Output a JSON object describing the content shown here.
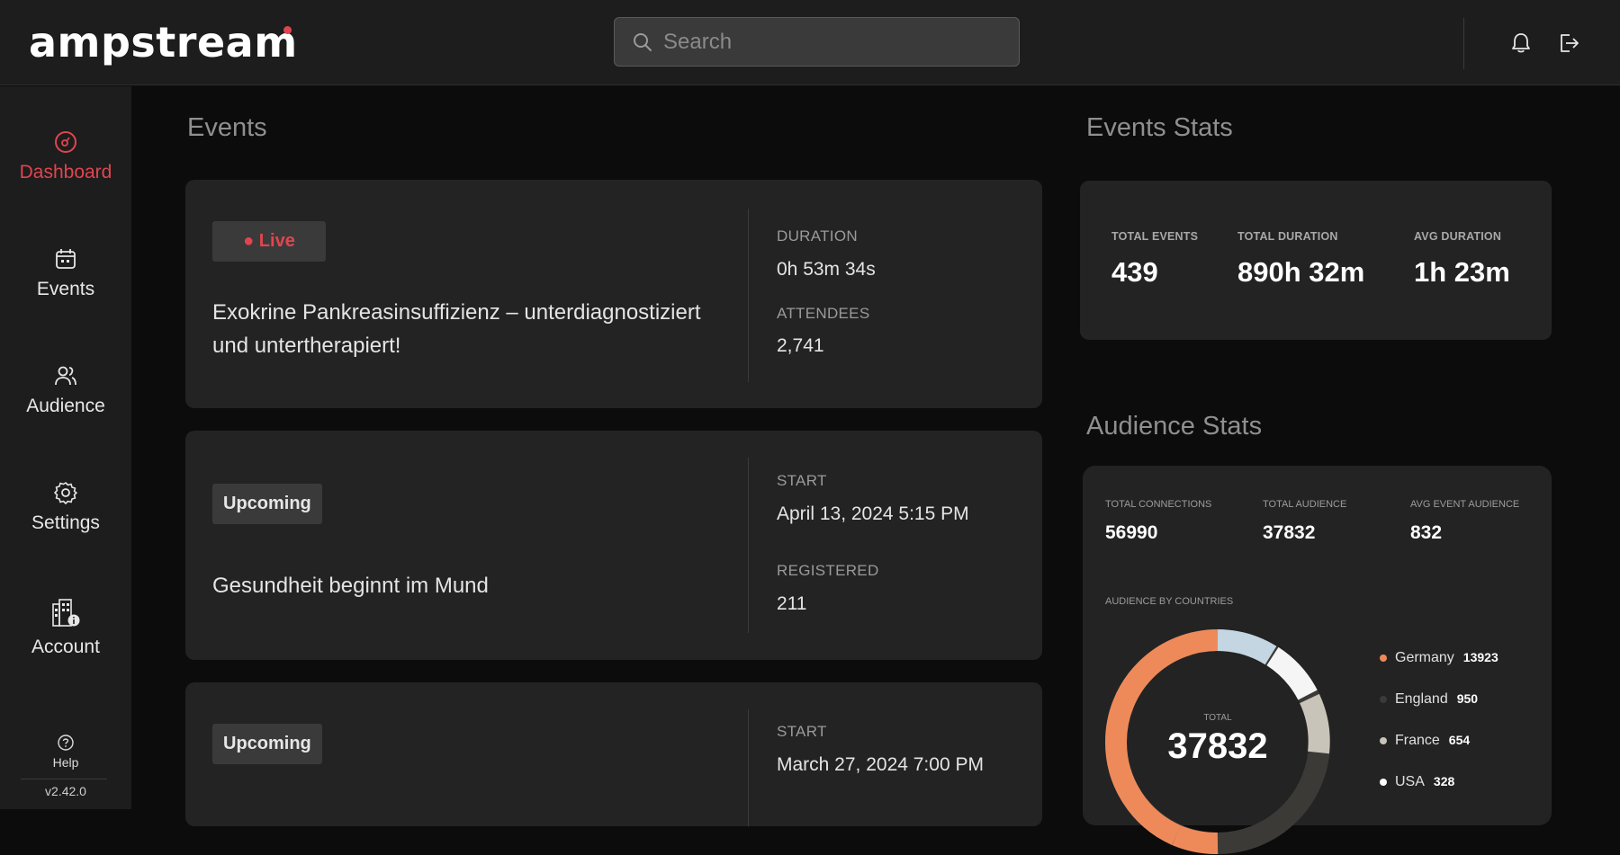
{
  "app": {
    "logo": "ampstream",
    "accent": "#e0454f"
  },
  "search": {
    "placeholder": "Search"
  },
  "sidebar": {
    "items": [
      {
        "label": "Dashboard",
        "icon": "dashboard-icon",
        "active": true
      },
      {
        "label": "Events",
        "icon": "calendar-icon",
        "active": false
      },
      {
        "label": "Audience",
        "icon": "users-icon",
        "active": false
      },
      {
        "label": "Settings",
        "icon": "gear-icon",
        "active": false
      },
      {
        "label": "Account",
        "icon": "account-icon",
        "active": false
      }
    ],
    "help": "Help",
    "version": "v2.42.0"
  },
  "events": {
    "title": "Events",
    "cards": [
      {
        "status": "Live",
        "title": "Exokrine Pankreasinsuffizienz – unterdiagnostiziert und untertherapiert!",
        "label1": "DURATION",
        "value1": "0h 53m 34s",
        "label2": "ATTENDEES",
        "value2": "2,741"
      },
      {
        "status": "Upcoming",
        "title": "Gesundheit beginnt im Mund",
        "label1": "START",
        "value1": "April 13, 2024 5:15 PM",
        "label2": "REGISTERED",
        "value2": "211"
      },
      {
        "status": "Upcoming",
        "title": "",
        "label1": "START",
        "value1": "March 27, 2024 7:00 PM"
      }
    ]
  },
  "events_stats": {
    "title": "Events Stats",
    "total_events_label": "TOTAL EVENTS",
    "total_events": "439",
    "total_duration_label": "TOTAL DURATION",
    "total_duration": "890h 32m",
    "avg_duration_label": "AVG DURATION",
    "avg_duration": "1h 23m"
  },
  "audience_stats": {
    "title": "Audience Stats",
    "total_connections_label": "TOTAL CONNECTIONS",
    "total_connections": "56990",
    "total_audience_label": "TOTAL AUDIENCE",
    "total_audience": "37832",
    "avg_event_audience_label": "AVG EVENT AUDIENCE",
    "avg_event_audience": "832",
    "by_countries_label": "AUDIENCE BY COUNTRIES",
    "donut_total_label": "TOTAL",
    "donut_total": "37832",
    "countries": [
      {
        "name": "Germany",
        "value": "13923",
        "color": "#ee8a5a"
      },
      {
        "name": "England",
        "value": "950",
        "color": "#3a3a3a"
      },
      {
        "name": "France",
        "value": "654",
        "color": "#c9c4b9"
      },
      {
        "name": "USA",
        "value": "328",
        "color": "#ffffff"
      }
    ]
  }
}
